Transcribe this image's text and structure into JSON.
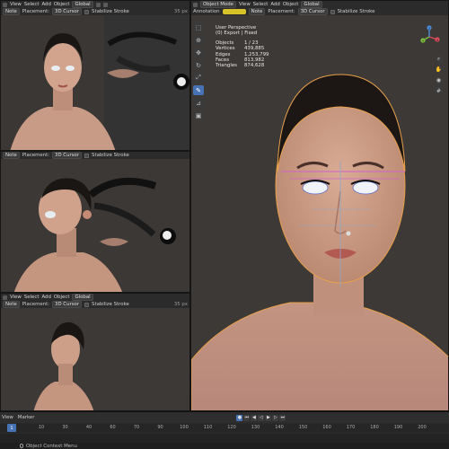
{
  "header_menu": {
    "view": "View",
    "select": "Select",
    "add": "Add",
    "object": "Object"
  },
  "main_header": {
    "mode": "Object Mode",
    "view": "View",
    "select": "Select",
    "add": "Add",
    "object": "Object",
    "transform": "Global",
    "annotation": "Annotation",
    "note": "Note",
    "placement": "Placement:",
    "cursor": "3D Cursor",
    "stabilize": "Stabilize Stroke"
  },
  "small_header": {
    "transform": "Global",
    "note": "Note",
    "placement": "Placement:",
    "cursor": "3D Cursor",
    "stabilize": "Stabilize Stroke",
    "radius": "35 px"
  },
  "viewport_info": {
    "perspective": "User Perspective",
    "collection": "(0) Export | Fixed",
    "stats": [
      {
        "k": "Objects",
        "v": "1 / 23"
      },
      {
        "k": "Vertices",
        "v": "439,885"
      },
      {
        "k": "Edges",
        "v": "1,253,799"
      },
      {
        "k": "Faces",
        "v": "813,982"
      },
      {
        "k": "Triangles",
        "v": "874,628"
      }
    ]
  },
  "gizmo": {
    "x": "X",
    "y": "Y",
    "z": "Z"
  },
  "timeline": {
    "view": "View",
    "marker": "Marker",
    "ticks": [
      "10",
      "30",
      "40",
      "60",
      "70",
      "90",
      "100",
      "110",
      "120",
      "130",
      "140",
      "150",
      "160",
      "170",
      "180",
      "190",
      "200"
    ],
    "current_frame": "1",
    "status": "Object Context Menu"
  },
  "colors": {
    "selection_outline": "#e8a04a",
    "accent": "#4772b3",
    "skin": "#c79a84"
  }
}
